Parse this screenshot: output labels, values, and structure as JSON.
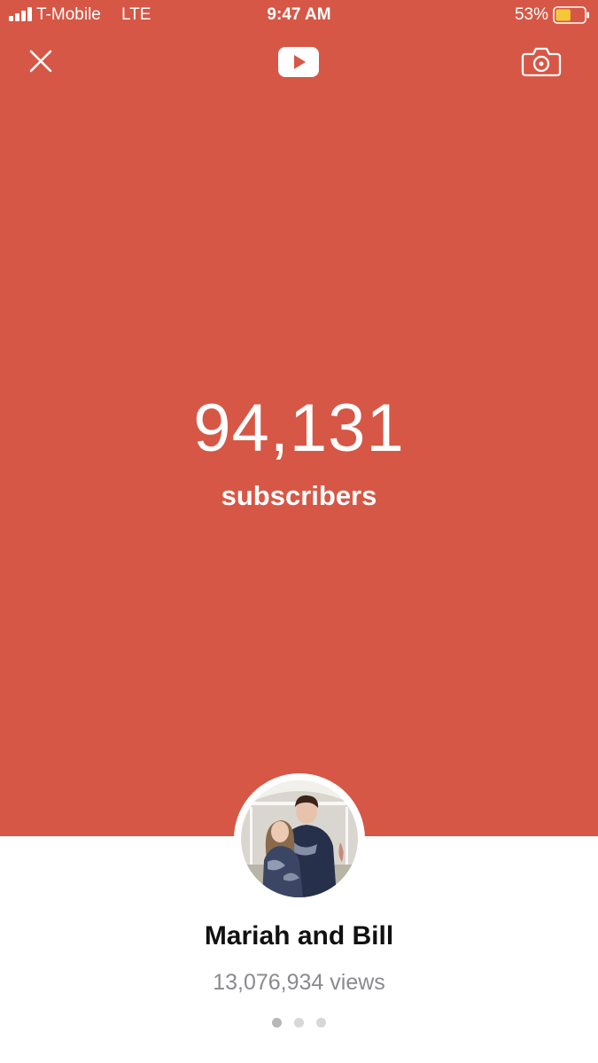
{
  "status_bar": {
    "carrier": "T-Mobile",
    "network": "LTE",
    "time": "9:47 AM",
    "battery_percent": "53%",
    "battery_level": 0.53,
    "signal_icon": "signal-bars-icon",
    "battery_icon": "battery-icon"
  },
  "toolbar": {
    "close_icon": "close-icon",
    "logo_icon": "youtube-logo-icon",
    "camera_icon": "camera-icon"
  },
  "counter": {
    "value": "94,131",
    "label": "subscribers"
  },
  "channel": {
    "name": "Mariah and Bill",
    "views": "13,076,934 views"
  },
  "pager": {
    "count": 3,
    "active_index": 0
  },
  "colors": {
    "accent": "#d65745",
    "background": "#ffffff",
    "name_text": "#111111",
    "muted_text": "#8a8a90",
    "battery_fill": "#f4c836"
  }
}
